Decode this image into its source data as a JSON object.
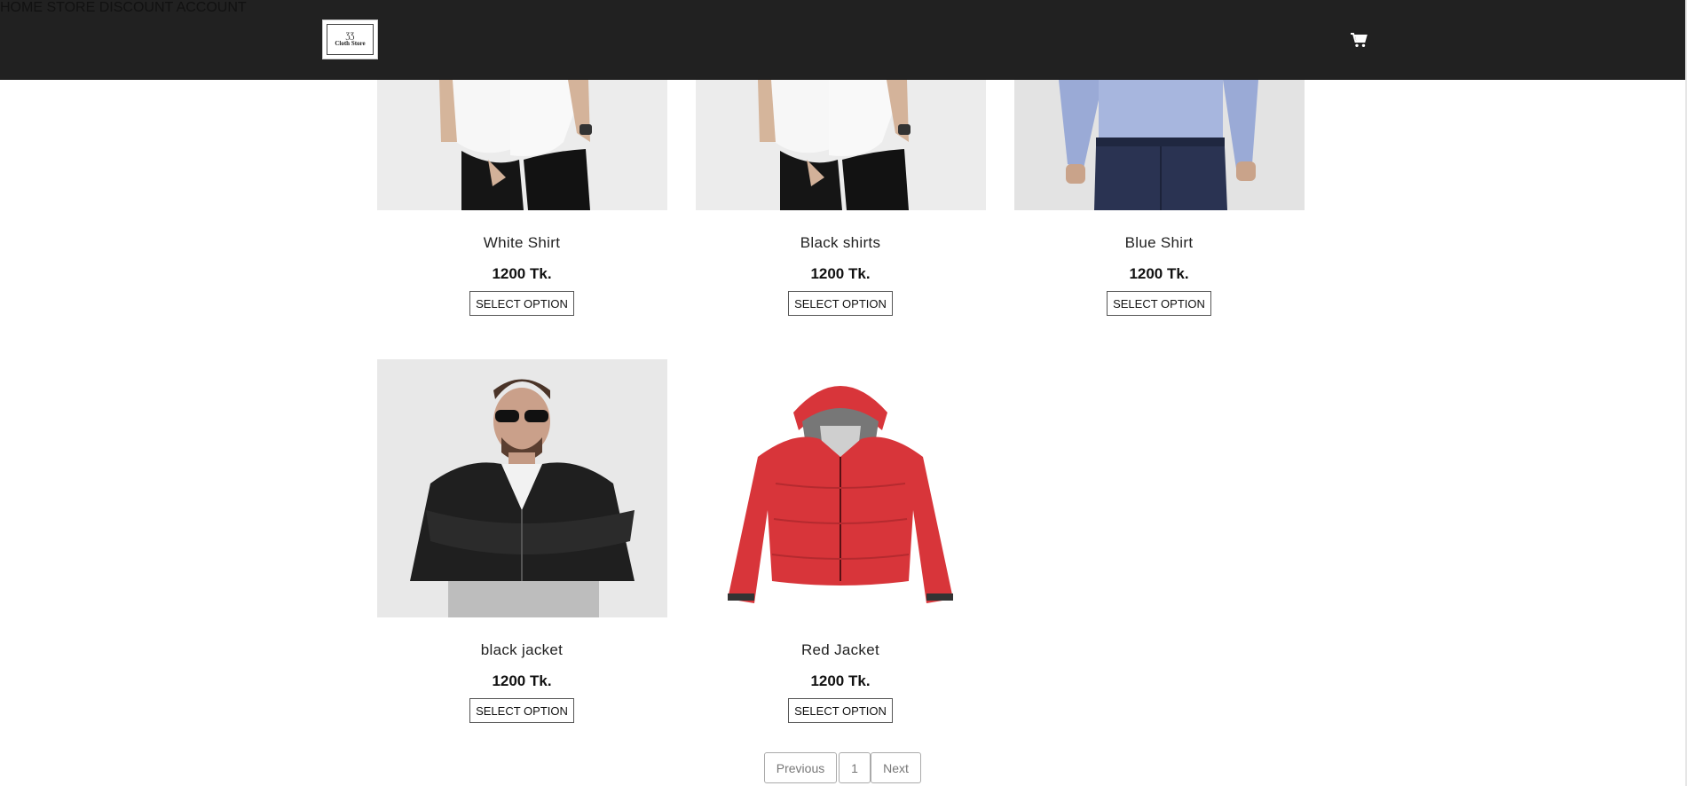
{
  "header": {
    "logo_mark": "ƷƷ",
    "logo_text": "Cloth Store",
    "nav": [
      "HOME",
      "STORE",
      "DISCOUNT",
      "ACCOUNT"
    ],
    "cart_icon": "cart-icon"
  },
  "products": [
    {
      "name": "White Shirt",
      "price": "1200 Tk.",
      "button": "SELECT OPTION",
      "image": "white-shirt-model"
    },
    {
      "name": "Black shirts",
      "price": "1200 Tk.",
      "button": "SELECT OPTION",
      "image": "white-shirt-model"
    },
    {
      "name": "Blue Shirt",
      "price": "1200 Tk.",
      "button": "SELECT OPTION",
      "image": "blue-shirt-model"
    },
    {
      "name": "black jacket",
      "price": "1200 Tk.",
      "button": "SELECT OPTION",
      "image": "leather-jacket-model"
    },
    {
      "name": "Red Jacket",
      "price": "1200 Tk.",
      "button": "SELECT OPTION",
      "image": "red-puffer-jacket"
    }
  ],
  "pagination": {
    "previous": "Previous",
    "page": "1",
    "next": "Next"
  },
  "colors": {
    "header_bg": "#212121",
    "jacket_red": "#d8353a",
    "shirt_blue": "#a7b6de"
  }
}
